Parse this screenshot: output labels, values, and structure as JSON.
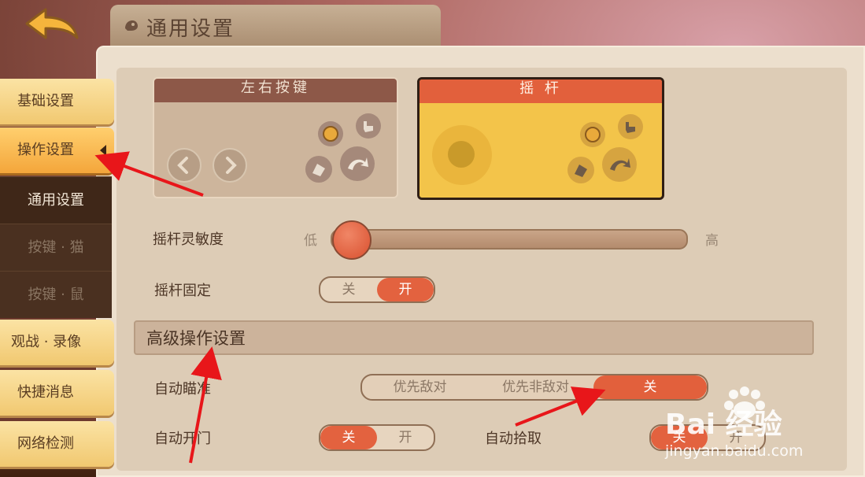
{
  "header": {
    "title": "通用设置"
  },
  "nav": {
    "items": [
      {
        "label": "基础设置"
      },
      {
        "label": "操作设置"
      },
      {
        "label": "观战 · 录像"
      },
      {
        "label": "快捷消息"
      },
      {
        "label": "网络检测"
      }
    ],
    "sub_items": [
      {
        "label": "通用设置"
      },
      {
        "label": "按键 · 猫"
      },
      {
        "label": "按键 · 鼠"
      }
    ]
  },
  "control_modes": {
    "option_a": "左右按键",
    "option_b": "摇 杆"
  },
  "settings": {
    "sensitivity": {
      "label": "摇杆灵敏度",
      "low": "低",
      "high": "高",
      "value_fraction": 0.05
    },
    "fixed": {
      "label": "摇杆固定",
      "off": "关",
      "on": "开",
      "selected": "开"
    },
    "advanced_title": "高级操作设置",
    "auto_aim": {
      "label": "自动瞄准",
      "options": [
        "优先敌对",
        "优先非敌对",
        "关"
      ],
      "selected": "关"
    },
    "auto_door": {
      "label": "自动开门",
      "off": "关",
      "on": "开",
      "selected": "关"
    },
    "auto_pickup": {
      "label": "自动拾取",
      "off": "关",
      "on": "开",
      "selected": "关"
    }
  },
  "watermark": {
    "brand": "Bai 经验",
    "url": "jingyan.baidu.com"
  },
  "colors": {
    "accent": "#e2603c",
    "panel": "#ecdfcd",
    "nav": "#f1c870",
    "annotation": "#e8161a"
  }
}
